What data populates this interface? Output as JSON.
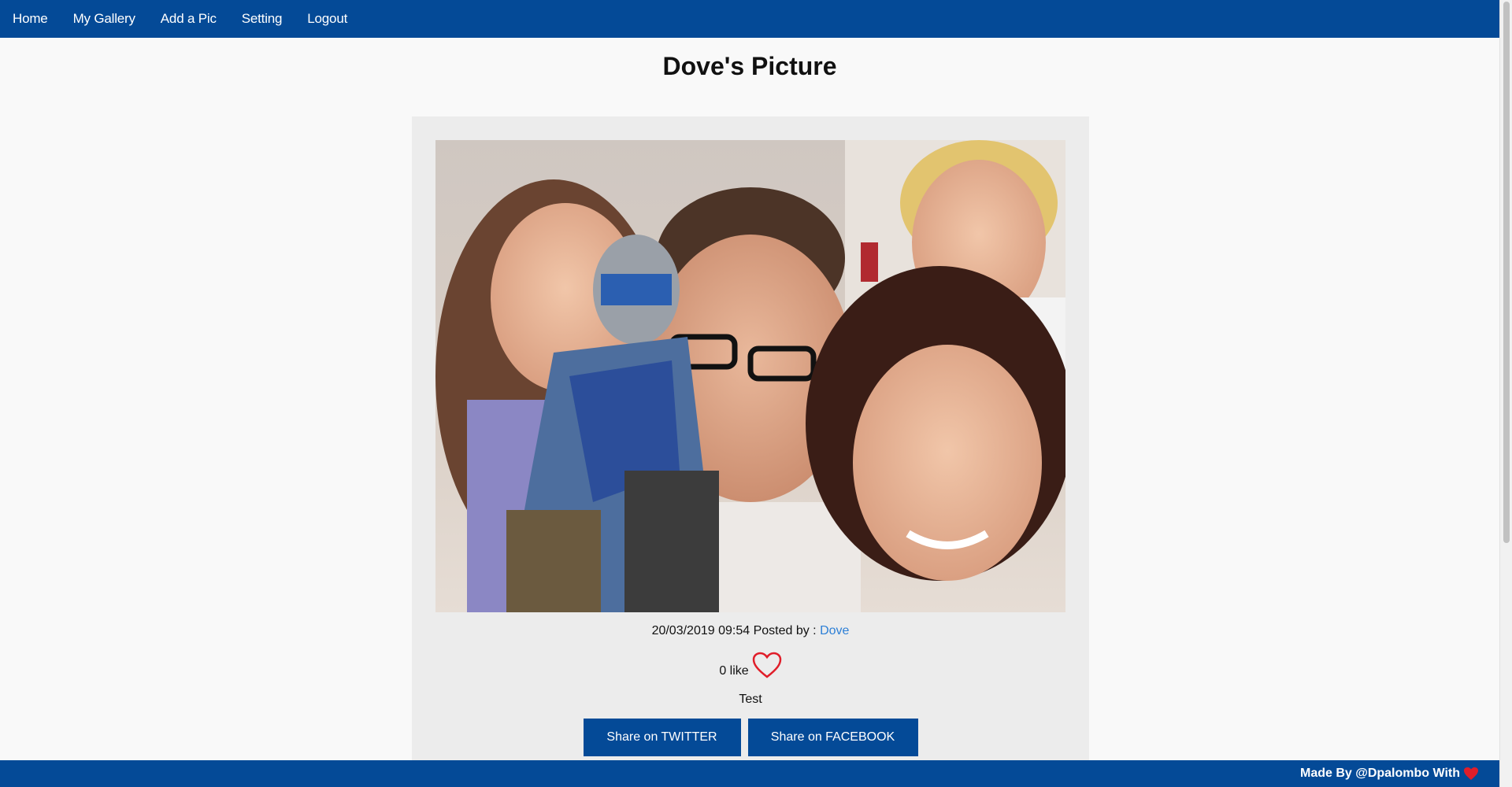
{
  "nav": {
    "items": [
      {
        "label": "Home"
      },
      {
        "label": "My Gallery"
      },
      {
        "label": "Add a Pic"
      },
      {
        "label": "Setting"
      },
      {
        "label": "Logout"
      }
    ]
  },
  "page": {
    "title": "Dove's Picture"
  },
  "post": {
    "date": "20/03/2019 09:54",
    "posted_by_label": "Posted by :",
    "author": "Dove",
    "likes_count_text": "0 like",
    "caption": "Test"
  },
  "share": {
    "twitter_label": "Share on TWITTER",
    "facebook_label": "Share on FACEBOOK"
  },
  "footer": {
    "text": "Made By @Dpalombo With"
  },
  "icons": {
    "like": "heart-outline-icon",
    "footer": "heart-filled-icon"
  },
  "colors": {
    "brand": "#044a97",
    "link": "#2c7fd6",
    "heart": "#e01e2a",
    "card_bg": "#ececec",
    "page_bg": "#f9f9f9"
  }
}
